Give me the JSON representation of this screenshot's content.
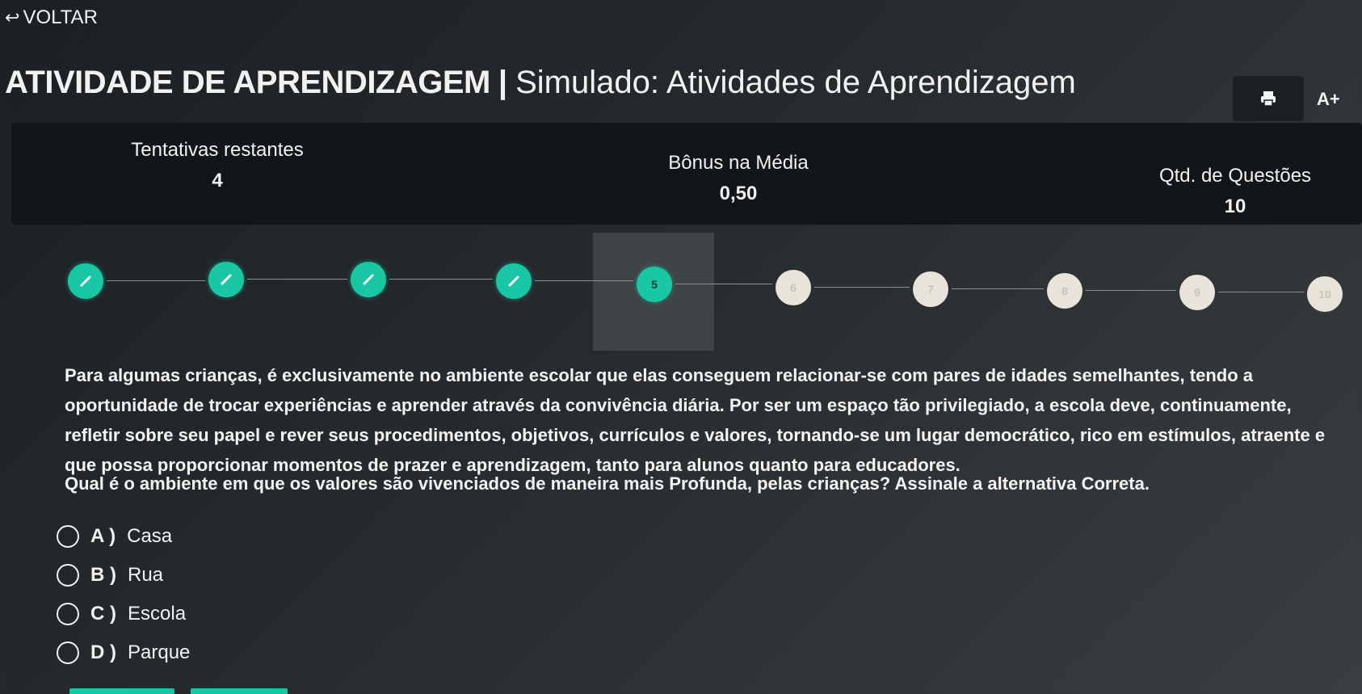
{
  "header": {
    "back_label": "VOLTAR",
    "title_strong": "ATIVIDADE DE APRENDIZAGEM",
    "title_separator": "|",
    "title_sub": "Simulado: Atividades de Aprendizagem",
    "font_button_label": "A+"
  },
  "stats": {
    "attempts_label": "Tentativas restantes",
    "attempts_value": "4",
    "bonus_label": "Bônus na Média",
    "bonus_value": "0,50",
    "questions_label": "Qtd. de Questões",
    "questions_value": "10"
  },
  "stepper": {
    "steps": [
      {
        "label": "",
        "state": "done"
      },
      {
        "label": "",
        "state": "done"
      },
      {
        "label": "",
        "state": "done"
      },
      {
        "label": "",
        "state": "done"
      },
      {
        "label": "5",
        "state": "current"
      },
      {
        "label": "6",
        "state": "pending"
      },
      {
        "label": "7",
        "state": "pending"
      },
      {
        "label": "8",
        "state": "pending"
      },
      {
        "label": "9",
        "state": "pending"
      },
      {
        "label": "10",
        "state": "pending"
      }
    ]
  },
  "question": {
    "text": "Para algumas crianças, é exclusivamente no ambiente escolar que elas conseguem relacionar-se com pares de idades semelhantes, tendo a oportunidade de trocar experiências e aprender através da convivência diária. Por ser um espaço tão privilegiado, a escola deve, continuamente, refletir sobre seu papel e rever seus procedimentos, objetivos, currículos e valores, tornando-se um lugar democrático, rico em estímulos, atraente e que possa proporcionar momentos de prazer e aprendizagem, tanto para alunos quanto para educadores.",
    "prompt": "Qual é o ambiente em que os valores são vivenciados de maneira mais Profunda, pelas crianças? Assinale a alternativa Correta.",
    "options": [
      {
        "letter": "A )",
        "text": "Casa"
      },
      {
        "letter": "B )",
        "text": "Rua"
      },
      {
        "letter": "C )",
        "text": "Escola"
      },
      {
        "letter": "D )",
        "text": "Parque"
      }
    ]
  },
  "colors": {
    "accent": "#19c7a4",
    "pending_step": "#e8e4da",
    "stats_bg": "#121618"
  }
}
